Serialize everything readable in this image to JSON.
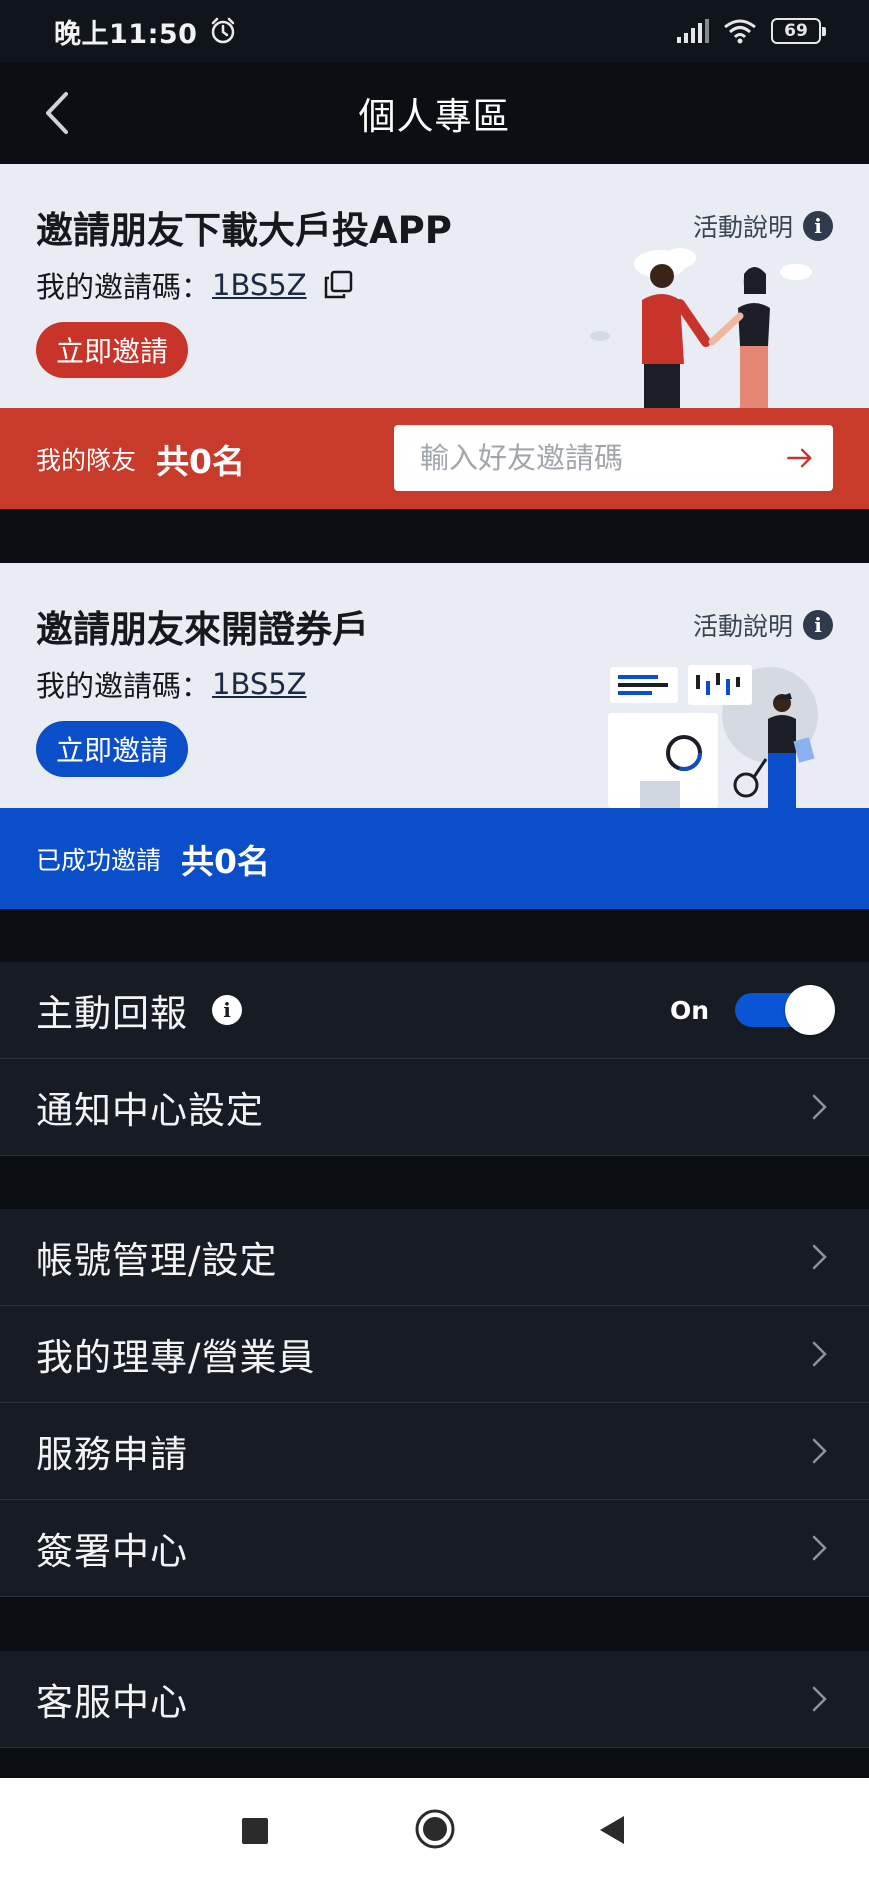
{
  "status_bar": {
    "time": "晚上11:50",
    "battery": "69"
  },
  "header": {
    "title": "個人專區"
  },
  "invite_app": {
    "headline": "邀請朋友下載大戶投APP",
    "info_label": "活動說明",
    "code_label": "我的邀請碼：",
    "code": "1BS5Z",
    "button_label": "立即邀請",
    "teammates_label": "我的隊友",
    "teammates_count": "共0名",
    "input_placeholder": "輸入好友邀請碼"
  },
  "invite_account": {
    "headline": "邀請朋友來開證券戶",
    "info_label": "活動說明",
    "code_label": "我的邀請碼：",
    "code": "1BS5Z",
    "button_label": "立即邀請",
    "success_label": "已成功邀請",
    "success_count": "共0名"
  },
  "settings": {
    "active_report": {
      "label": "主動回報",
      "toggle_text": "On",
      "enabled": true
    },
    "group1": [
      {
        "label": "通知中心設定"
      }
    ],
    "group2": [
      {
        "label": "帳號管理/設定"
      },
      {
        "label": "我的理專/營業員"
      },
      {
        "label": "服務申請"
      },
      {
        "label": "簽署中心"
      }
    ],
    "group3": [
      {
        "label": "客服中心"
      }
    ]
  },
  "colors": {
    "accent_red": "#c83a2a",
    "accent_blue": "#0a4fc9",
    "list_bg": "#171c24"
  }
}
